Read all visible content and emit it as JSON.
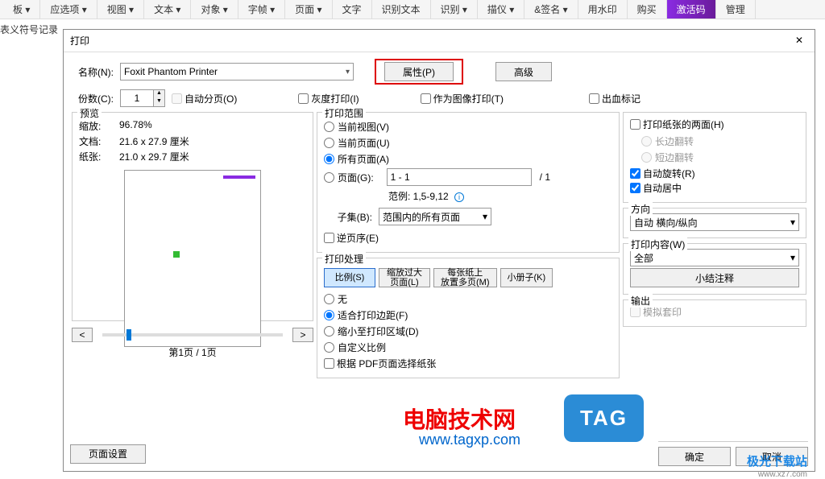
{
  "toolbar": {
    "items": [
      "板 ▾",
      "应选项 ▾",
      "视图 ▾",
      "文本 ▾",
      "对象 ▾",
      "字帧 ▾",
      "页面 ▾",
      "文字",
      "识别文本",
      "识别 ▾",
      "描仪 ▾",
      "&签名 ▾",
      "用水印",
      "购买",
      "激活码",
      "管理"
    ]
  },
  "sideText": "表义符号记录",
  "dialog": {
    "title": "打印",
    "close": "✕",
    "nameLabel": "名称(N):",
    "printerName": "Foxit Phantom Printer",
    "propBtn": "属性(P)",
    "advBtn": "高级",
    "copiesLabel": "份数(C):",
    "copiesVal": "1",
    "collate": "自动分页(O)",
    "gray": "灰度打印(I)",
    "asImage": "作为图像打印(T)",
    "bleed": "出血标记",
    "preview": {
      "legend": "预览",
      "zoomLabel": "缩放:",
      "zoomVal": "96.78%",
      "docLabel": "文档:",
      "docVal": "21.6 x 27.9 厘米",
      "paperLabel": "纸张:",
      "paperVal": "21.0 x 29.7 厘米",
      "navPrev": "<",
      "navNext": ">",
      "pageIndicator": "第1页 / 1页"
    },
    "range": {
      "legend": "打印范围",
      "curView": "当前视图(V)",
      "curPage": "当前页面(U)",
      "allPages": "所有页面(A)",
      "pages": "页面(G):",
      "pagesVal": "1 - 1",
      "total": "/ 1",
      "exampleLabel": "范例: 1,5-9,12",
      "subsetLabel": "子集(B):",
      "subsetVal": "范围内的所有页面",
      "reverse": "逆页序(E)"
    },
    "handling": {
      "legend": "打印处理",
      "scale": "比例(S)",
      "shrinkLarge": "缩放过大\n页面(L)",
      "multi": "每张纸上\n放置多页(M)",
      "booklet": "小册子(K)",
      "none": "无",
      "fit": "适合打印边距(F)",
      "shrink": "缩小至打印区域(D)",
      "custom": "自定义比例",
      "byPdf": "根据 PDF页面选择纸张"
    },
    "duplex": {
      "both": "打印纸张的两面(H)",
      "longEdge": "长边翻转",
      "shortEdge": "短边翻转",
      "autoRotate": "自动旋转(R)",
      "autoCenter": "自动居中"
    },
    "orient": {
      "legend": "方向",
      "val": "自动 横向/纵向"
    },
    "content": {
      "legend": "打印内容(W)",
      "val": "全部",
      "summary": "小结注释"
    },
    "output": {
      "legend": "输出",
      "sim": "模拟套印"
    },
    "pageSetup": "页面设置",
    "ok": "确定",
    "cancel": "取消"
  },
  "watermark": {
    "main": "电脑技术网",
    "url": "www.tagxp.com",
    "tag": "TAG",
    "logo": "极光下载站",
    "logoSub": "www.xz7.com"
  }
}
